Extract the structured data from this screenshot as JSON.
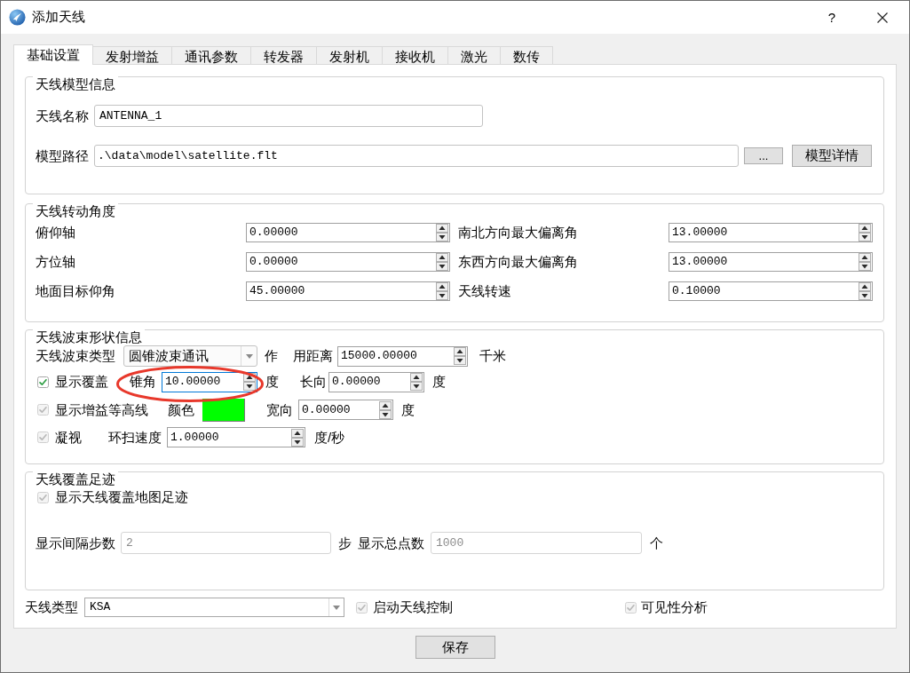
{
  "window": {
    "title": "添加天线",
    "help": "?"
  },
  "tabs": [
    {
      "label": "基础设置",
      "selected": true
    },
    {
      "label": "发射增益",
      "selected": false
    },
    {
      "label": "通讯参数",
      "selected": false
    },
    {
      "label": "转发器",
      "selected": false
    },
    {
      "label": "发射机",
      "selected": false
    },
    {
      "label": "接收机",
      "selected": false
    },
    {
      "label": "激光",
      "selected": false
    },
    {
      "label": "数传",
      "selected": false
    }
  ],
  "model_info": {
    "title": "天线模型信息",
    "name": {
      "label": "天线名称",
      "value": "ANTENNA_1"
    },
    "path": {
      "label": "模型路径",
      "value": ".\\data\\model\\satellite.flt"
    },
    "browse_button": "...",
    "details_button": "模型详情"
  },
  "rotation": {
    "title": "天线转动角度",
    "fields": [
      {
        "label": "俯仰轴",
        "value": "0.00000"
      },
      {
        "label": "南北方向最大偏离角",
        "value": "13.00000"
      },
      {
        "label": "方位轴",
        "value": "0.00000"
      },
      {
        "label": "东西方向最大偏离角",
        "value": "13.00000"
      },
      {
        "label": "地面目标仰角",
        "value": "45.00000"
      },
      {
        "label": "天线转速",
        "value": "0.10000"
      }
    ]
  },
  "beam": {
    "title": "天线波束形状信息",
    "beam_type": {
      "label": "天线波束类型",
      "value": "圆锥波束通讯"
    },
    "range": {
      "label_parts": [
        "作",
        "用距离"
      ],
      "value": "15000.00000",
      "unit": "千米"
    },
    "show_coverage": {
      "label": "显示覆盖",
      "checked": true,
      "disabled": false
    },
    "cone_angle": {
      "label": "锥角",
      "value": "10.00000",
      "unit": "度",
      "focused": true
    },
    "length": {
      "label": "长向",
      "value": "0.00000",
      "unit": "度"
    },
    "show_contours": {
      "label": "显示增益等高线",
      "checked": true,
      "disabled": true
    },
    "color": {
      "label": "颜色",
      "color": "#00ff00"
    },
    "width_angle": {
      "label": "宽向",
      "value": "0.00000",
      "unit": "度"
    },
    "stare": {
      "label": "凝视",
      "checked": true,
      "disabled": true
    },
    "scan_speed": {
      "label": "环扫速度",
      "value": "1.00000",
      "unit": "度/秒"
    }
  },
  "annotation": {
    "kind": "ellipse"
  },
  "footprint": {
    "title": "天线覆盖足迹",
    "show_footprint": {
      "label": "显示天线覆盖地图足迹",
      "checked": true,
      "disabled": true
    },
    "step": {
      "label": "显示间隔步数",
      "value": "2",
      "unit": "步",
      "disabled": true
    },
    "total": {
      "label": "显示总点数",
      "value": "1000",
      "unit": "个",
      "disabled": true
    }
  },
  "bottom": {
    "antenna_type": {
      "label": "天线类型",
      "value": "KSA"
    },
    "options": [
      {
        "label": "启动天线控制",
        "checked": true,
        "disabled": true
      },
      {
        "label": "可见性分析",
        "checked": true,
        "disabled": true
      }
    ]
  },
  "save_button": "保存"
}
